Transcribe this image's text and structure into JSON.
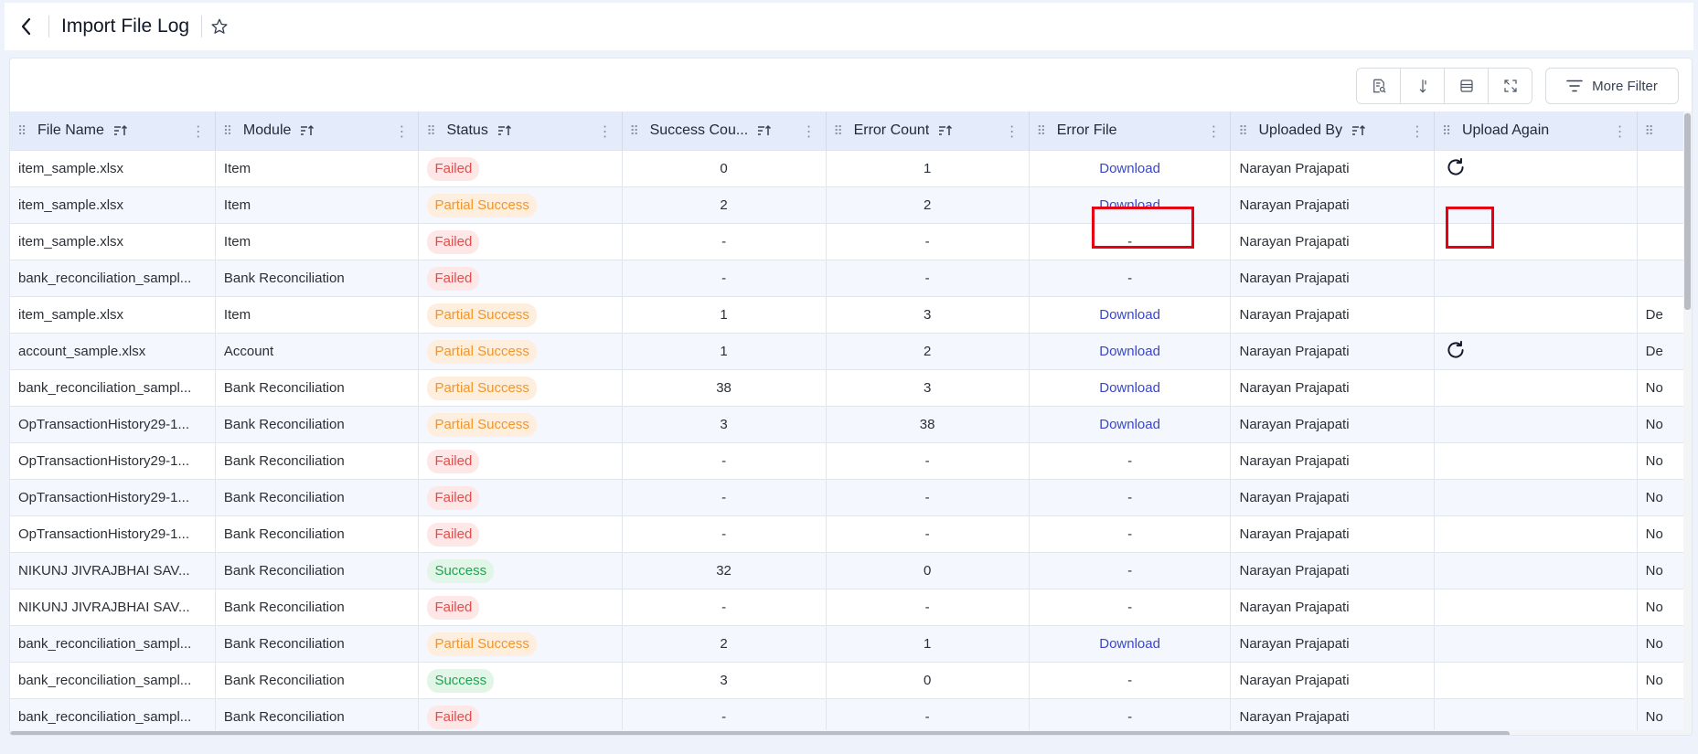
{
  "header": {
    "title": "Import File Log",
    "back_icon": "chevron-left-icon",
    "favorite_icon": "star-outline-icon"
  },
  "toolbar": {
    "buttons": [
      {
        "name": "search-doc-icon"
      },
      {
        "name": "sort-vertical-icon"
      },
      {
        "name": "row-density-icon"
      },
      {
        "name": "fullscreen-icon"
      }
    ],
    "more_filter_label": "More Filter"
  },
  "columns": [
    {
      "label": "File Name",
      "sortable": true
    },
    {
      "label": "Module",
      "sortable": true
    },
    {
      "label": "Status",
      "sortable": true
    },
    {
      "label": "Success Cou...",
      "sortable": true
    },
    {
      "label": "Error Count",
      "sortable": true
    },
    {
      "label": "Error File",
      "sortable": false
    },
    {
      "label": "Uploaded By",
      "sortable": true
    },
    {
      "label": "Upload Again",
      "sortable": false
    },
    {
      "label": "",
      "sortable": false
    }
  ],
  "rows": [
    {
      "file": "item_sample.xlsx",
      "module": "Item",
      "status": "Failed",
      "success": "0",
      "error": "1",
      "error_file": "Download",
      "by": "Narayan Prajapati",
      "upload_again": true,
      "extra": ""
    },
    {
      "file": "item_sample.xlsx",
      "module": "Item",
      "status": "Partial Success",
      "success": "2",
      "error": "2",
      "error_file": "Download",
      "by": "Narayan Prajapati",
      "upload_again": false,
      "extra": ""
    },
    {
      "file": "item_sample.xlsx",
      "module": "Item",
      "status": "Failed",
      "success": "-",
      "error": "-",
      "error_file": "-",
      "by": "Narayan Prajapati",
      "upload_again": false,
      "extra": ""
    },
    {
      "file": "bank_reconciliation_sampl...",
      "module": "Bank Reconciliation",
      "status": "Failed",
      "success": "-",
      "error": "-",
      "error_file": "-",
      "by": "Narayan Prajapati",
      "upload_again": false,
      "extra": ""
    },
    {
      "file": "item_sample.xlsx",
      "module": "Item",
      "status": "Partial Success",
      "success": "1",
      "error": "3",
      "error_file": "Download",
      "by": "Narayan Prajapati",
      "upload_again": false,
      "extra": "De"
    },
    {
      "file": "account_sample.xlsx",
      "module": "Account",
      "status": "Partial Success",
      "success": "1",
      "error": "2",
      "error_file": "Download",
      "by": "Narayan Prajapati",
      "upload_again": true,
      "extra": "De"
    },
    {
      "file": "bank_reconciliation_sampl...",
      "module": "Bank Reconciliation",
      "status": "Partial Success",
      "success": "38",
      "error": "3",
      "error_file": "Download",
      "by": "Narayan Prajapati",
      "upload_again": false,
      "extra": "No"
    },
    {
      "file": "OpTransactionHistory29-1...",
      "module": "Bank Reconciliation",
      "status": "Partial Success",
      "success": "3",
      "error": "38",
      "error_file": "Download",
      "by": "Narayan Prajapati",
      "upload_again": false,
      "extra": "No"
    },
    {
      "file": "OpTransactionHistory29-1...",
      "module": "Bank Reconciliation",
      "status": "Failed",
      "success": "-",
      "error": "-",
      "error_file": "-",
      "by": "Narayan Prajapati",
      "upload_again": false,
      "extra": "No"
    },
    {
      "file": "OpTransactionHistory29-1...",
      "module": "Bank Reconciliation",
      "status": "Failed",
      "success": "-",
      "error": "-",
      "error_file": "-",
      "by": "Narayan Prajapati",
      "upload_again": false,
      "extra": "No"
    },
    {
      "file": "OpTransactionHistory29-1...",
      "module": "Bank Reconciliation",
      "status": "Failed",
      "success": "-",
      "error": "-",
      "error_file": "-",
      "by": "Narayan Prajapati",
      "upload_again": false,
      "extra": "No"
    },
    {
      "file": "NIKUNJ JIVRAJBHAI SAV...",
      "module": "Bank Reconciliation",
      "status": "Success",
      "success": "32",
      "error": "0",
      "error_file": "-",
      "by": "Narayan Prajapati",
      "upload_again": false,
      "extra": "No"
    },
    {
      "file": "NIKUNJ JIVRAJBHAI SAV...",
      "module": "Bank Reconciliation",
      "status": "Failed",
      "success": "-",
      "error": "-",
      "error_file": "-",
      "by": "Narayan Prajapati",
      "upload_again": false,
      "extra": "No"
    },
    {
      "file": "bank_reconciliation_sampl...",
      "module": "Bank Reconciliation",
      "status": "Partial Success",
      "success": "2",
      "error": "1",
      "error_file": "Download",
      "by": "Narayan Prajapati",
      "upload_again": false,
      "extra": "No"
    },
    {
      "file": "bank_reconciliation_sampl...",
      "module": "Bank Reconciliation",
      "status": "Success",
      "success": "3",
      "error": "0",
      "error_file": "-",
      "by": "Narayan Prajapati",
      "upload_again": false,
      "extra": "No"
    },
    {
      "file": "bank_reconciliation_sampl...",
      "module": "Bank Reconciliation",
      "status": "Failed",
      "success": "-",
      "error": "-",
      "error_file": "-",
      "by": "Narayan Prajapati",
      "upload_again": false,
      "extra": "No"
    }
  ],
  "status_colors": {
    "Failed": "#e04f4f",
    "Partial Success": "#f2962c",
    "Success": "#22a352"
  },
  "link_color": "#3b47c6",
  "highlight_color": "#e60012"
}
